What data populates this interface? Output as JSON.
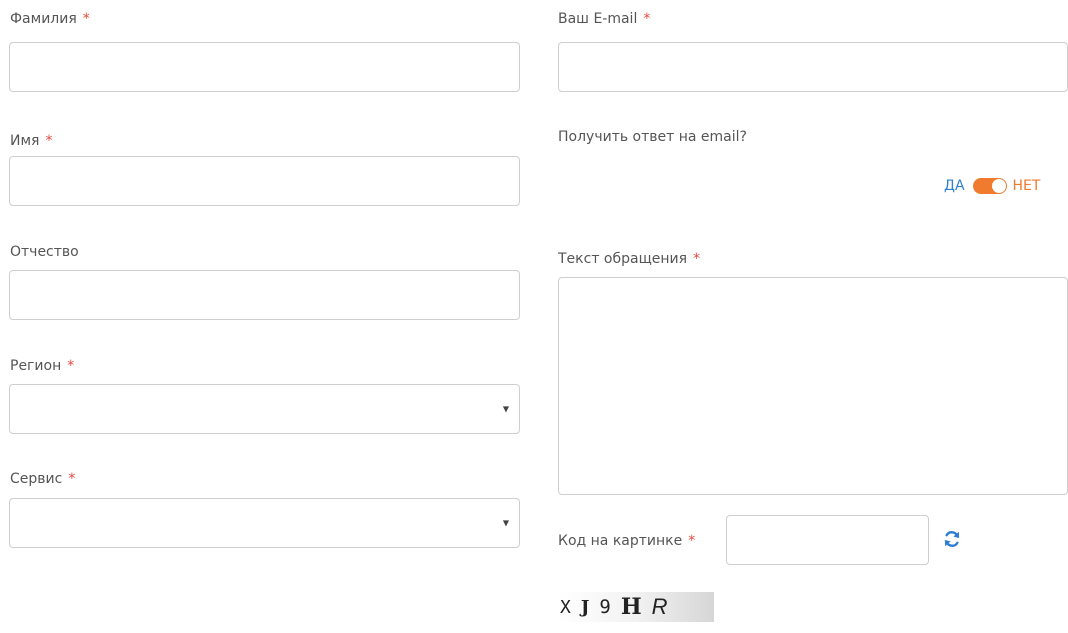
{
  "form": {
    "last_name": {
      "label": "Фамилия",
      "required_mark": "*"
    },
    "first_name": {
      "label": "Имя",
      "required_mark": "*"
    },
    "patronymic": {
      "label": "Отчество"
    },
    "region": {
      "label": "Регион",
      "required_mark": "*",
      "value": ""
    },
    "service": {
      "label": "Сервис",
      "required_mark": "*",
      "value": ""
    },
    "email": {
      "label": "Ваш E-mail",
      "required_mark": "*"
    },
    "email_reply": {
      "label": "Получить ответ на email?",
      "yes_label": "ДА",
      "no_label": "НЕТ",
      "state": "НЕТ"
    },
    "message": {
      "label": "Текст обращения",
      "required_mark": "*"
    },
    "captcha": {
      "label": "Код на картинке",
      "required_mark": "*",
      "image_text": [
        "X",
        "J",
        "9",
        "H",
        "R"
      ]
    }
  },
  "colors": {
    "required": "#e8483c",
    "accent_orange": "#f07a2e",
    "accent_blue": "#2f7fd0",
    "border": "#cfcfcf",
    "label_text": "#555555"
  },
  "icons": {
    "refresh": "refresh-icon",
    "dropdown": "chevron-down-icon"
  }
}
